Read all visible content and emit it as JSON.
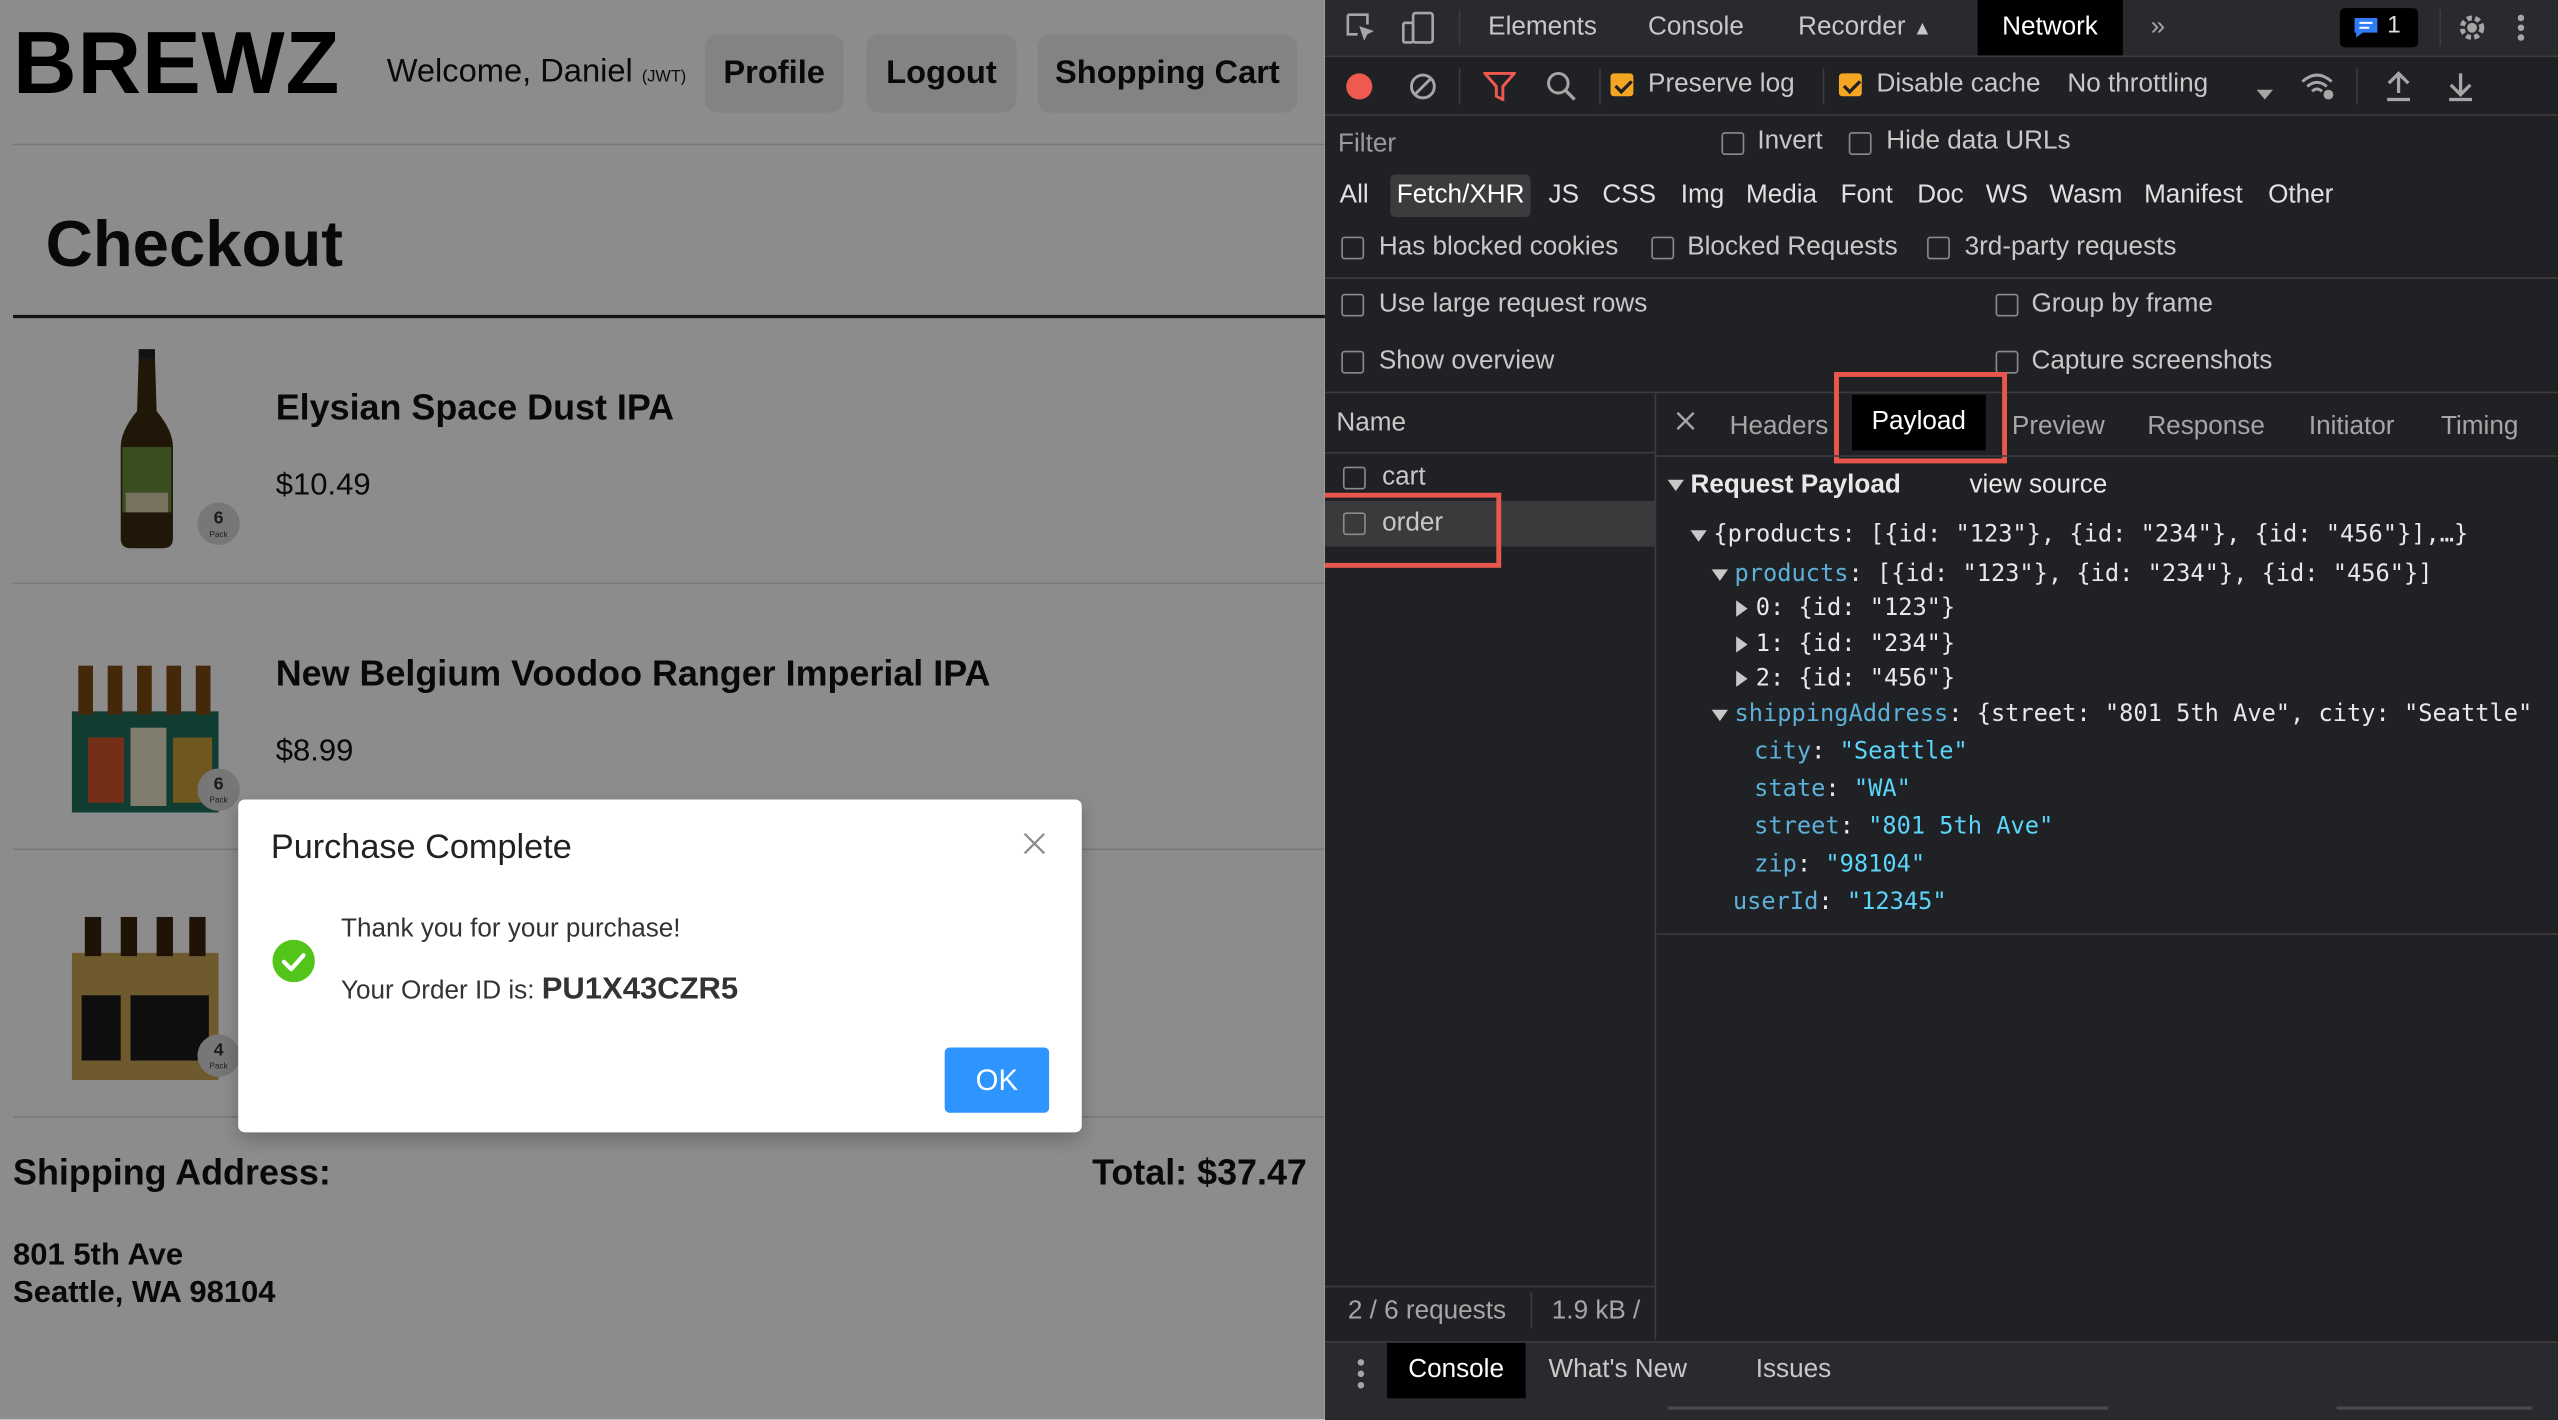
{
  "app": {
    "logo": "BREWZ",
    "welcome": "Welcome, Daniel",
    "welcome_tag": "(JWT)",
    "nav": {
      "profile": "Profile",
      "logout": "Logout",
      "cart": "Shopping Cart"
    },
    "page_title": "Checkout",
    "products": [
      {
        "name": "Elysian Space Dust IPA",
        "price": "$10.49",
        "pack": "6",
        "pack_label": "Pack"
      },
      {
        "name": "New Belgium Voodoo Ranger Imperial IPA",
        "price": "$8.99",
        "pack": "6",
        "pack_label": "Pack"
      },
      {
        "name": "",
        "price": "",
        "pack": "4",
        "pack_label": "Pack"
      }
    ],
    "shipping_label": "Shipping Address:",
    "total_label": "Total: $37.47",
    "address_line1": "801 5th Ave",
    "address_line2": "Seattle, WA 98104"
  },
  "modal": {
    "title": "Purchase Complete",
    "message": "Thank you for your purchase!",
    "order_prefix": "Your Order ID is: ",
    "order_id": "PU1X43CZR5",
    "ok": "OK"
  },
  "devtools": {
    "tabs": [
      "Elements",
      "Console",
      "Recorder",
      "Network"
    ],
    "active_tab": "Network",
    "more": "»",
    "message_count": "1",
    "preserve_log": "Preserve log",
    "disable_cache": "Disable cache",
    "throttling": "No throttling",
    "filter_placeholder": "Filter",
    "invert": "Invert",
    "hide_data_urls": "Hide data URLs",
    "types": [
      "All",
      "Fetch/XHR",
      "JS",
      "CSS",
      "Img",
      "Media",
      "Font",
      "Doc",
      "WS",
      "Wasm",
      "Manifest",
      "Other"
    ],
    "active_type": "Fetch/XHR",
    "has_blocked_cookies": "Has blocked cookies",
    "blocked_requests": "Blocked Requests",
    "third_party": "3rd-party requests",
    "large_rows": "Use large request rows",
    "group_by_frame": "Group by frame",
    "show_overview": "Show overview",
    "capture_screenshots": "Capture screenshots",
    "name_header": "Name",
    "requests": [
      "cart",
      "order"
    ],
    "selected_request": "order",
    "detail_tabs": [
      "Headers",
      "Payload",
      "Preview",
      "Response",
      "Initiator",
      "Timing"
    ],
    "active_detail_tab": "Payload",
    "payload_title": "Request Payload",
    "view_source": "view source",
    "payload_lines": {
      "root": "{products: [{id: \"123\"}, {id: \"234\"}, {id: \"456\"}],…}",
      "products_key": "products",
      "products_val": "[{id: \"123\"}, {id: \"234\"}, {id: \"456\"}]",
      "items": [
        {
          "key": "0",
          "val": "{id: \"123\"}"
        },
        {
          "key": "1",
          "val": "{id: \"234\"}"
        },
        {
          "key": "2",
          "val": "{id: \"456\"}"
        }
      ],
      "shipping_key": "shippingAddress",
      "shipping_val": "{street: \"801 5th Ave\", city: \"Seattle\"",
      "fields": [
        {
          "key": "city",
          "val": "\"Seattle\""
        },
        {
          "key": "state",
          "val": "\"WA\""
        },
        {
          "key": "street",
          "val": "\"801 5th Ave\""
        },
        {
          "key": "zip",
          "val": "\"98104\""
        }
      ],
      "user_key": "userId",
      "user_val": "\"12345\""
    },
    "status_requests": "2 / 6 requests",
    "status_size": "1.9 kB /",
    "drawer_tabs": [
      "Console",
      "What's New",
      "Issues"
    ],
    "active_drawer_tab": "Console"
  },
  "colors": {
    "accent_red": "#e9574c",
    "ok_blue": "#2e95ff",
    "success_green": "#52c41a",
    "checkbox_orange": "#f4a623"
  }
}
